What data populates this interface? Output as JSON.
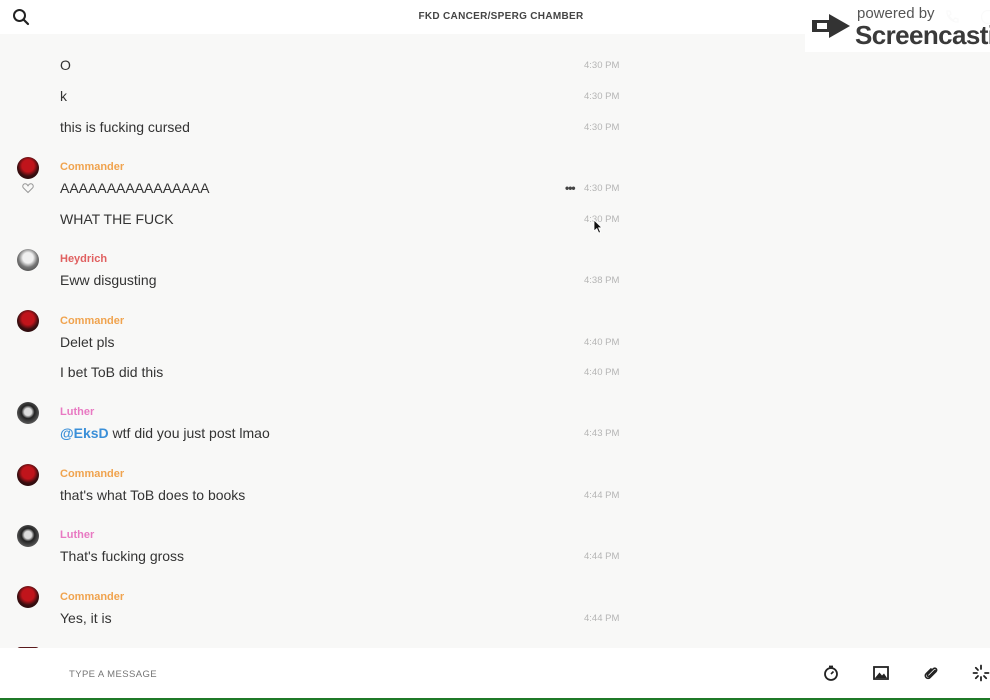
{
  "header": {
    "title": "FKD CANCER/SPERG CHAMBER"
  },
  "watermark": {
    "line1": "powered by",
    "line2": "Screencastify"
  },
  "messages": [
    {
      "text": "O",
      "time": "4:30 PM"
    },
    {
      "text": "k",
      "time": "4:30 PM"
    },
    {
      "text": "this is fucking cursed",
      "time": "4:30 PM"
    },
    {
      "author": "Commander",
      "text": "AAAAAAAAAAAAAAAA",
      "time": "4:30 PM"
    },
    {
      "text": "WHAT THE FUCK",
      "time": "4:30 PM"
    },
    {
      "author": "Heydrich",
      "text": "Eww disgusting",
      "time": "4:38 PM"
    },
    {
      "author": "Commander",
      "text": "Delet pls",
      "time": "4:40 PM"
    },
    {
      "text": "I bet ToB did this",
      "time": "4:40 PM"
    },
    {
      "author": "Luther",
      "mention": "@EksD",
      "text": " wtf did you just post lmao",
      "time": "4:43 PM"
    },
    {
      "author": "Commander",
      "text": "that's what ToB does to books",
      "time": "4:44 PM"
    },
    {
      "author": "Luther",
      "text": "That's fucking gross",
      "time": "4:44 PM"
    },
    {
      "author": "Commander",
      "text": "Yes, it is",
      "time": "4:44 PM"
    }
  ],
  "composer": {
    "placeholder": "TYPE A MESSAGE"
  },
  "icons": [
    "search-icon",
    "phone-icon",
    "info-icon",
    "heart-icon",
    "more-icon",
    "timer-icon",
    "image-icon",
    "attachment-icon",
    "sparkle-icon"
  ],
  "colors": {
    "commander": "#f0a34e",
    "heydrich": "#e06060",
    "luther": "#e879c2",
    "mention": "#3a8fd8"
  }
}
